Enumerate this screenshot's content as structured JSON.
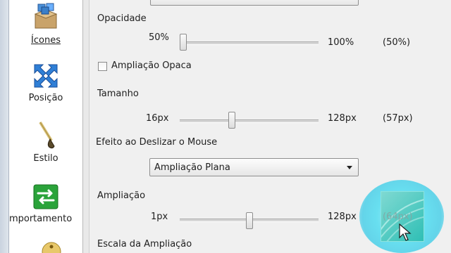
{
  "sidebar": {
    "items": [
      {
        "label": "Ícones"
      },
      {
        "label": "Posição"
      },
      {
        "label": "Estilo"
      },
      {
        "label": "omportamento"
      }
    ]
  },
  "settings": {
    "opacidade": {
      "label": "Opacidade",
      "min": "50%",
      "max": "100%",
      "value": "(50%)",
      "level": 0
    },
    "ampliacao_opaca": {
      "label": "Ampliação Opaca",
      "checked": false
    },
    "tamanho": {
      "label": "Tamanho",
      "min": "16px",
      "max": "128px",
      "value": "(57px)",
      "level": 0.37
    },
    "efeito": {
      "label": "Efeito ao Deslizar o Mouse",
      "selected": "Ampliação Plana"
    },
    "ampliacao": {
      "label": "Ampliação",
      "min": "1px",
      "max": "128px",
      "value": "(64px)",
      "level": 0.5
    },
    "escala": {
      "label": "Escala da Ampliação"
    }
  },
  "colors": {
    "cursor_highlight": "#40d0e8",
    "preview": "#2fbfb5"
  }
}
